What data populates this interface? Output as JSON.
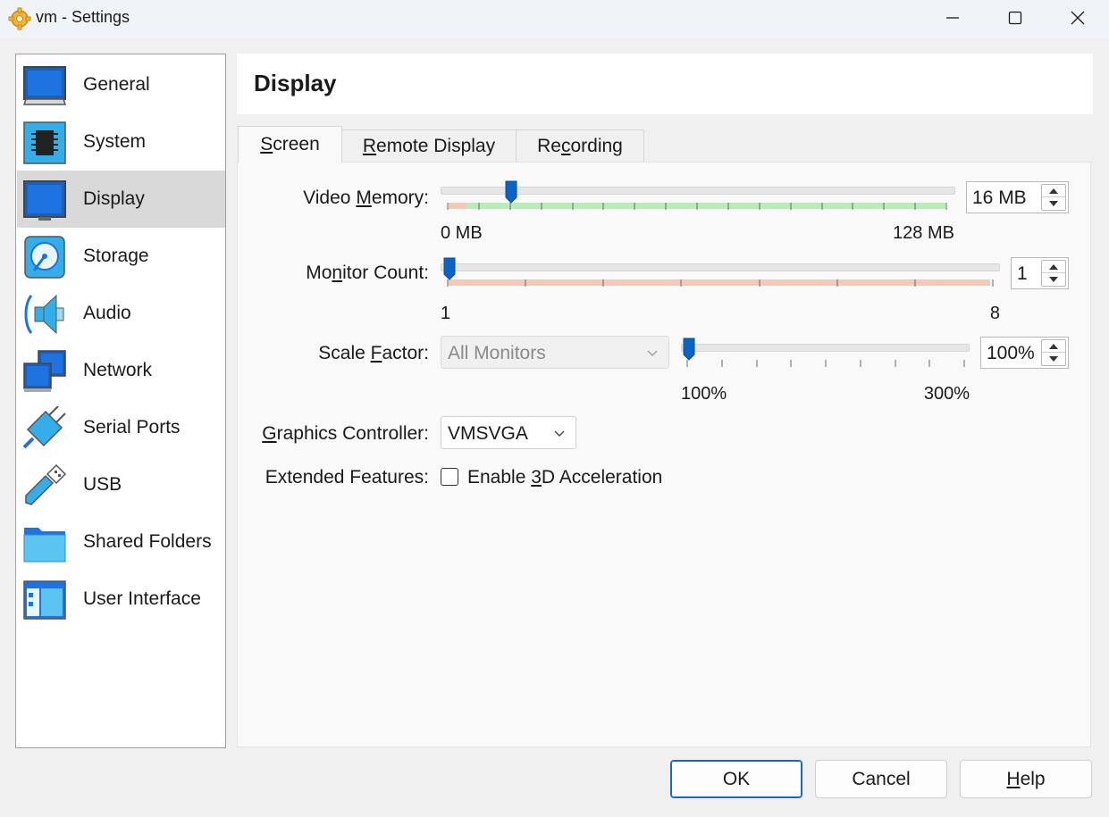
{
  "window": {
    "title": "vm - Settings"
  },
  "sidebar": {
    "items": [
      {
        "label": "General",
        "icon": "general-icon"
      },
      {
        "label": "System",
        "icon": "chip-icon"
      },
      {
        "label": "Display",
        "icon": "monitor-icon",
        "selected": true
      },
      {
        "label": "Storage",
        "icon": "disk-icon"
      },
      {
        "label": "Audio",
        "icon": "speaker-icon"
      },
      {
        "label": "Network",
        "icon": "network-icon"
      },
      {
        "label": "Serial Ports",
        "icon": "serial-port-icon"
      },
      {
        "label": "USB",
        "icon": "usb-icon"
      },
      {
        "label": "Shared Folders",
        "icon": "folder-icon"
      },
      {
        "label": "User Interface",
        "icon": "ui-layout-icon"
      }
    ]
  },
  "page": {
    "title": "Display"
  },
  "tabs": [
    {
      "label": "Screen",
      "mnemonic_index": 0,
      "active": true
    },
    {
      "label": "Remote Display",
      "mnemonic_index": 0
    },
    {
      "label": "Recording",
      "mnemonic_index": 2
    }
  ],
  "screen": {
    "video_memory": {
      "label": "Video Memory:",
      "value": "16 MB",
      "value_mb": 16,
      "min_label": "0 MB",
      "max_label": "128 MB",
      "min": 0,
      "max": 128
    },
    "monitor_count": {
      "label": "Monitor Count:",
      "value": "1",
      "min_label": "1",
      "max_label": "8",
      "min": 1,
      "max": 8
    },
    "scale_factor": {
      "label": "Scale Factor:",
      "monitor_select": "All Monitors",
      "value": "100%",
      "min_label": "100%",
      "max_label": "300%",
      "min": 100,
      "max": 300
    },
    "graphics_controller": {
      "label": "Graphics Controller:",
      "value": "VMSVGA"
    },
    "extended_features": {
      "label": "Extended Features:",
      "checkbox_label": "Enable 3D Acceleration",
      "checked": false
    }
  },
  "buttons": {
    "ok": "OK",
    "cancel": "Cancel",
    "help": "Help"
  },
  "colors": {
    "accent": "#0b63c5",
    "selected_item": "#d9d9d9",
    "green_zone": "#b6efb3",
    "red_zone": "#f7c8b6"
  }
}
